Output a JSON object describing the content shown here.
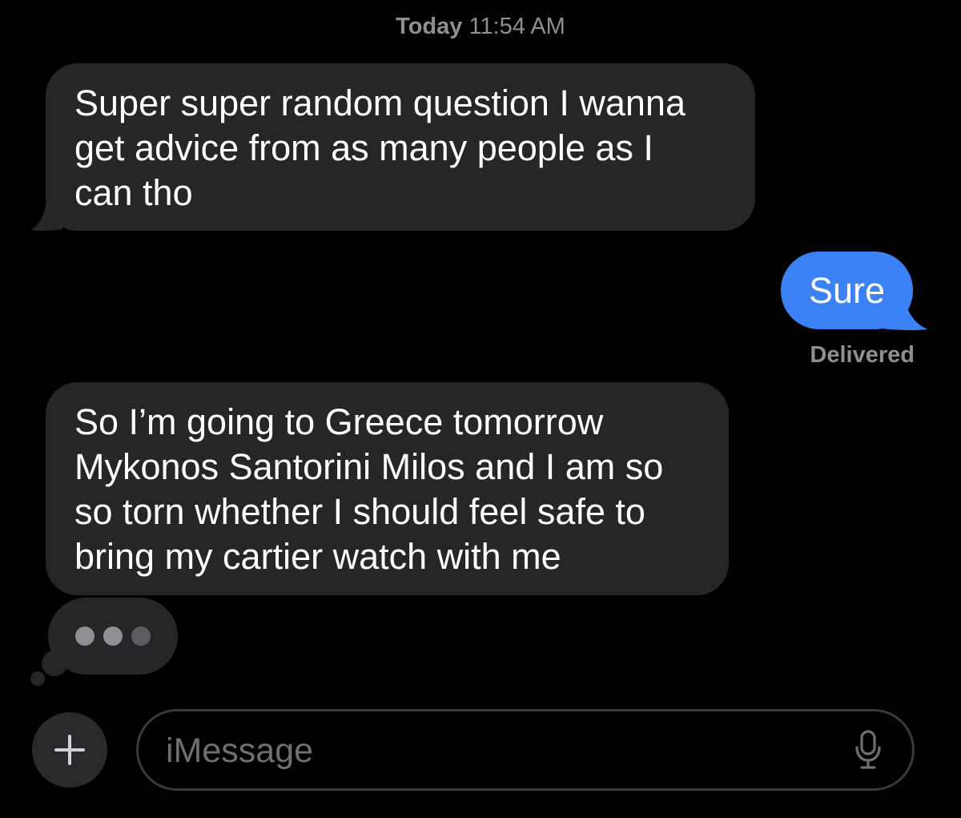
{
  "header": {
    "day": "Today",
    "time": "11:54 AM"
  },
  "messages": [
    {
      "direction": "incoming",
      "lines": [
        "Super super random question I wanna",
        "get advice from as many people as I",
        "can tho"
      ]
    },
    {
      "direction": "outgoing",
      "text": "Sure",
      "status": "Delivered"
    },
    {
      "direction": "incoming",
      "lines": [
        "So I’m going to Greece tomorrow",
        "Mykonos Santorini Milos and I am so",
        "so torn whether I should feel safe to",
        "bring my cartier watch with me"
      ]
    }
  ],
  "typing_indicator": {
    "visible": true,
    "icon": "typing-dots-icon"
  },
  "composer": {
    "placeholder": "iMessage",
    "add_icon": "plus-icon",
    "mic_icon": "microphone-icon"
  },
  "colors": {
    "background": "#000000",
    "incoming_bubble": "#262629",
    "outgoing_bubble": "#3b82f6",
    "secondary_text": "#8e8e93"
  }
}
